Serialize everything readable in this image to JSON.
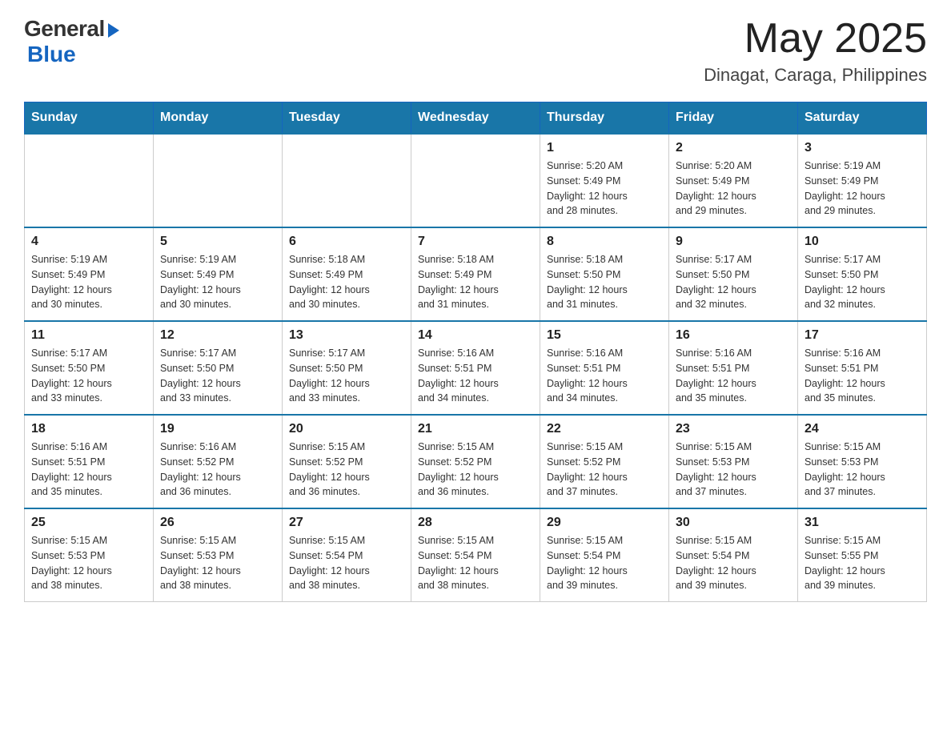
{
  "header": {
    "logo_general": "General",
    "logo_blue": "Blue",
    "month_title": "May 2025",
    "location": "Dinagat, Caraga, Philippines"
  },
  "days_of_week": [
    "Sunday",
    "Monday",
    "Tuesday",
    "Wednesday",
    "Thursday",
    "Friday",
    "Saturday"
  ],
  "weeks": [
    [
      {
        "day": "",
        "info": ""
      },
      {
        "day": "",
        "info": ""
      },
      {
        "day": "",
        "info": ""
      },
      {
        "day": "",
        "info": ""
      },
      {
        "day": "1",
        "info": "Sunrise: 5:20 AM\nSunset: 5:49 PM\nDaylight: 12 hours\nand 28 minutes."
      },
      {
        "day": "2",
        "info": "Sunrise: 5:20 AM\nSunset: 5:49 PM\nDaylight: 12 hours\nand 29 minutes."
      },
      {
        "day": "3",
        "info": "Sunrise: 5:19 AM\nSunset: 5:49 PM\nDaylight: 12 hours\nand 29 minutes."
      }
    ],
    [
      {
        "day": "4",
        "info": "Sunrise: 5:19 AM\nSunset: 5:49 PM\nDaylight: 12 hours\nand 30 minutes."
      },
      {
        "day": "5",
        "info": "Sunrise: 5:19 AM\nSunset: 5:49 PM\nDaylight: 12 hours\nand 30 minutes."
      },
      {
        "day": "6",
        "info": "Sunrise: 5:18 AM\nSunset: 5:49 PM\nDaylight: 12 hours\nand 30 minutes."
      },
      {
        "day": "7",
        "info": "Sunrise: 5:18 AM\nSunset: 5:49 PM\nDaylight: 12 hours\nand 31 minutes."
      },
      {
        "day": "8",
        "info": "Sunrise: 5:18 AM\nSunset: 5:50 PM\nDaylight: 12 hours\nand 31 minutes."
      },
      {
        "day": "9",
        "info": "Sunrise: 5:17 AM\nSunset: 5:50 PM\nDaylight: 12 hours\nand 32 minutes."
      },
      {
        "day": "10",
        "info": "Sunrise: 5:17 AM\nSunset: 5:50 PM\nDaylight: 12 hours\nand 32 minutes."
      }
    ],
    [
      {
        "day": "11",
        "info": "Sunrise: 5:17 AM\nSunset: 5:50 PM\nDaylight: 12 hours\nand 33 minutes."
      },
      {
        "day": "12",
        "info": "Sunrise: 5:17 AM\nSunset: 5:50 PM\nDaylight: 12 hours\nand 33 minutes."
      },
      {
        "day": "13",
        "info": "Sunrise: 5:17 AM\nSunset: 5:50 PM\nDaylight: 12 hours\nand 33 minutes."
      },
      {
        "day": "14",
        "info": "Sunrise: 5:16 AM\nSunset: 5:51 PM\nDaylight: 12 hours\nand 34 minutes."
      },
      {
        "day": "15",
        "info": "Sunrise: 5:16 AM\nSunset: 5:51 PM\nDaylight: 12 hours\nand 34 minutes."
      },
      {
        "day": "16",
        "info": "Sunrise: 5:16 AM\nSunset: 5:51 PM\nDaylight: 12 hours\nand 35 minutes."
      },
      {
        "day": "17",
        "info": "Sunrise: 5:16 AM\nSunset: 5:51 PM\nDaylight: 12 hours\nand 35 minutes."
      }
    ],
    [
      {
        "day": "18",
        "info": "Sunrise: 5:16 AM\nSunset: 5:51 PM\nDaylight: 12 hours\nand 35 minutes."
      },
      {
        "day": "19",
        "info": "Sunrise: 5:16 AM\nSunset: 5:52 PM\nDaylight: 12 hours\nand 36 minutes."
      },
      {
        "day": "20",
        "info": "Sunrise: 5:15 AM\nSunset: 5:52 PM\nDaylight: 12 hours\nand 36 minutes."
      },
      {
        "day": "21",
        "info": "Sunrise: 5:15 AM\nSunset: 5:52 PM\nDaylight: 12 hours\nand 36 minutes."
      },
      {
        "day": "22",
        "info": "Sunrise: 5:15 AM\nSunset: 5:52 PM\nDaylight: 12 hours\nand 37 minutes."
      },
      {
        "day": "23",
        "info": "Sunrise: 5:15 AM\nSunset: 5:53 PM\nDaylight: 12 hours\nand 37 minutes."
      },
      {
        "day": "24",
        "info": "Sunrise: 5:15 AM\nSunset: 5:53 PM\nDaylight: 12 hours\nand 37 minutes."
      }
    ],
    [
      {
        "day": "25",
        "info": "Sunrise: 5:15 AM\nSunset: 5:53 PM\nDaylight: 12 hours\nand 38 minutes."
      },
      {
        "day": "26",
        "info": "Sunrise: 5:15 AM\nSunset: 5:53 PM\nDaylight: 12 hours\nand 38 minutes."
      },
      {
        "day": "27",
        "info": "Sunrise: 5:15 AM\nSunset: 5:54 PM\nDaylight: 12 hours\nand 38 minutes."
      },
      {
        "day": "28",
        "info": "Sunrise: 5:15 AM\nSunset: 5:54 PM\nDaylight: 12 hours\nand 38 minutes."
      },
      {
        "day": "29",
        "info": "Sunrise: 5:15 AM\nSunset: 5:54 PM\nDaylight: 12 hours\nand 39 minutes."
      },
      {
        "day": "30",
        "info": "Sunrise: 5:15 AM\nSunset: 5:54 PM\nDaylight: 12 hours\nand 39 minutes."
      },
      {
        "day": "31",
        "info": "Sunrise: 5:15 AM\nSunset: 5:55 PM\nDaylight: 12 hours\nand 39 minutes."
      }
    ]
  ]
}
